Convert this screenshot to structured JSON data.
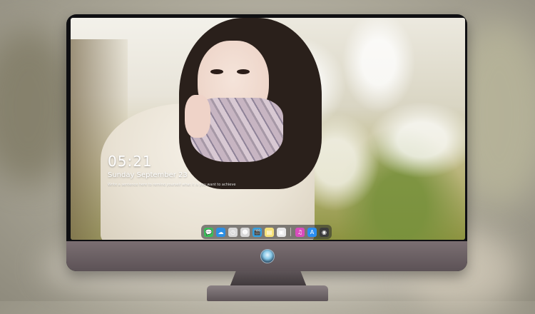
{
  "lockscreen": {
    "time": "05:21",
    "date": "Sunday September 23",
    "quote": "Write a sentence here to remind yourself what it is you want to achieve"
  },
  "dock": {
    "icons": [
      {
        "name": "messages-icon",
        "glyph": "💬",
        "color": "#3bbf5a"
      },
      {
        "name": "chat-icon",
        "glyph": "☁",
        "color": "#2d8fe3"
      },
      {
        "name": "clock-icon",
        "glyph": "◷",
        "color": "#d9d9d9"
      },
      {
        "name": "finder-icon",
        "glyph": "☻",
        "color": "#d8d8d8"
      },
      {
        "name": "video-icon",
        "glyph": "🎬",
        "color": "#34a0e0"
      },
      {
        "name": "notes-icon",
        "glyph": "▤",
        "color": "#f6e27a"
      },
      {
        "name": "photos-icon",
        "glyph": "▣",
        "color": "#e8e8e8"
      },
      {
        "name": "music-icon",
        "glyph": "♫",
        "color": "#d94cbd"
      },
      {
        "name": "appstore-icon",
        "glyph": "A",
        "color": "#2b8ef0"
      },
      {
        "name": "camera-icon",
        "glyph": "◉",
        "color": "#3c3c3c"
      }
    ]
  }
}
